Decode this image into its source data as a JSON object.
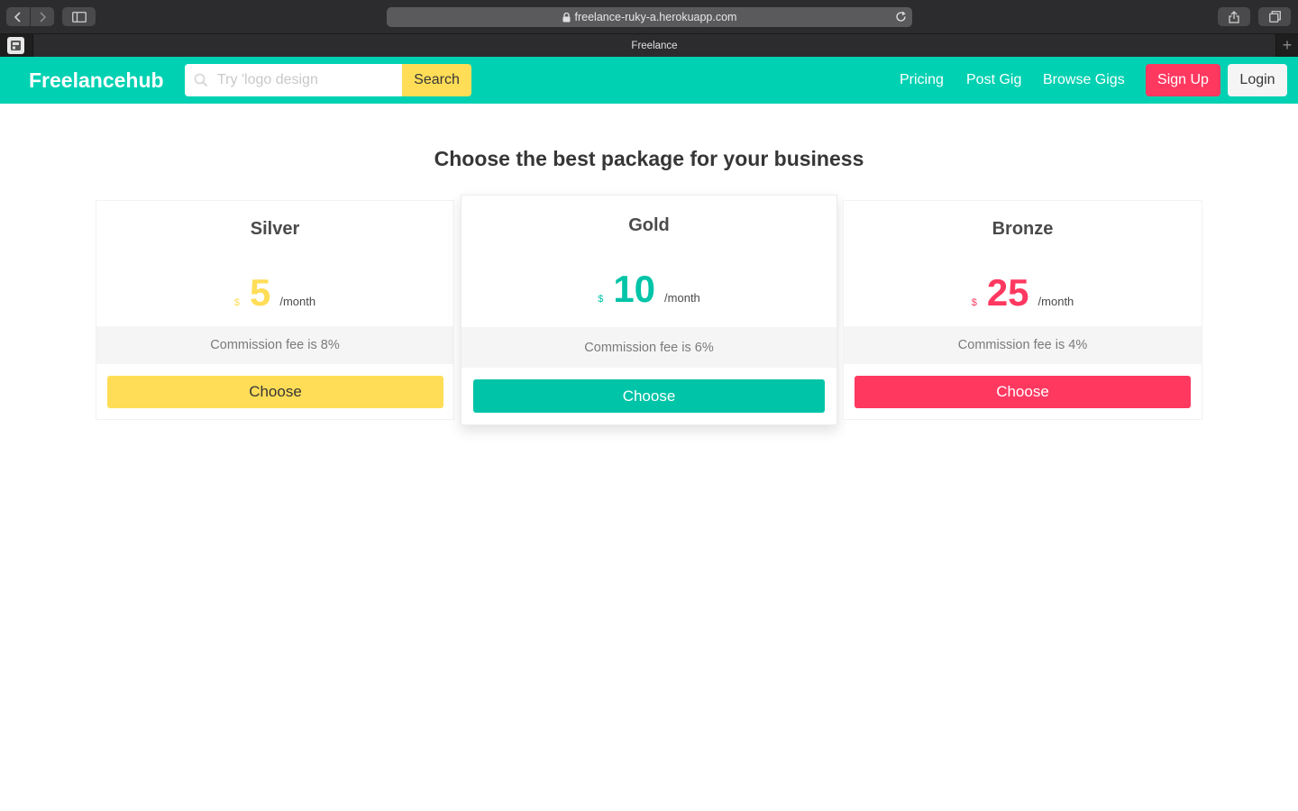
{
  "browser": {
    "url": "freelance-ruky-a.herokuapp.com",
    "tab_title": "Freelance",
    "new_tab_label": "+"
  },
  "header": {
    "logo": "Freelancehub",
    "search": {
      "placeholder": "Try 'logo design",
      "button_label": "Search"
    },
    "nav": {
      "pricing": "Pricing",
      "post_gig": "Post Gig",
      "browse_gigs": "Browse Gigs",
      "sign_up": "Sign Up",
      "login": "Login"
    }
  },
  "main": {
    "heading": "Choose the best package for your business",
    "plans": [
      {
        "name": "Silver",
        "currency": "$",
        "price": "5",
        "period": "/month",
        "fee": "Commission fee is 8%",
        "button": "Choose",
        "color": "#ffdd57"
      },
      {
        "name": "Gold",
        "currency": "$",
        "price": "10",
        "period": "/month",
        "fee": "Commission fee is 6%",
        "button": "Choose",
        "color": "#00c4a7"
      },
      {
        "name": "Bronze",
        "currency": "$",
        "price": "25",
        "period": "/month",
        "fee": "Commission fee is 4%",
        "button": "Choose",
        "color": "#ff3860"
      }
    ]
  },
  "colors": {
    "brand": "#00d1b2",
    "warning": "#ffdd57",
    "danger": "#ff3860",
    "light": "#f5f5f5"
  }
}
